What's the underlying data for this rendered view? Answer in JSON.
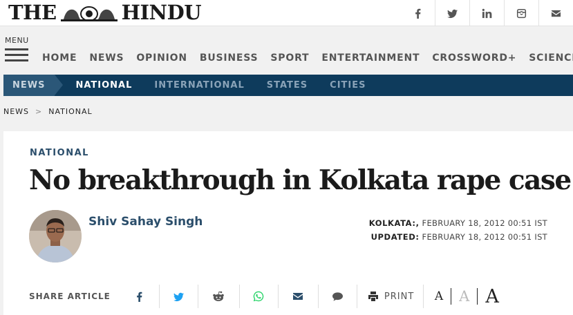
{
  "site": {
    "logo_left": "THE",
    "logo_right": "HINDU"
  },
  "social": [
    {
      "icon": "facebook-icon"
    },
    {
      "icon": "twitter-icon"
    },
    {
      "icon": "linkedin-icon"
    },
    {
      "icon": "instagram-icon"
    },
    {
      "icon": "email-icon"
    }
  ],
  "menu": {
    "label": "MENU"
  },
  "nav": [
    "HOME",
    "NEWS",
    "OPINION",
    "BUSINESS",
    "SPORT",
    "ENTERTAINMENT",
    "CROSSWORD+",
    "SCIENCE"
  ],
  "sections": {
    "current": "NEWS",
    "items": [
      "NATIONAL",
      "INTERNATIONAL",
      "STATES",
      "CITIES"
    ],
    "active": "NATIONAL"
  },
  "breadcrumb": {
    "first": "NEWS",
    "separator": ">",
    "second": "NATIONAL"
  },
  "article": {
    "kicker": "NATIONAL",
    "headline": "No breakthrough in Kolkata rape case",
    "author": "Shiv Sahay Singh",
    "dateline_place": "KOLKATA:,",
    "dateline_date": "FEBRUARY 18, 2012 00:51 IST",
    "updated_label": "UPDATED:",
    "updated_date": "FEBRUARY 18, 2012 00:51 IST"
  },
  "share": {
    "label": "SHARE ARTICLE",
    "print_label": "PRINT",
    "font_small": "A",
    "font_medium": "A",
    "font_large": "A"
  },
  "colors": {
    "brand_navy": "#0e3b5c",
    "accent_blue": "#2b4e6b",
    "twitter": "#1da1f2",
    "whatsapp": "#25d366"
  }
}
